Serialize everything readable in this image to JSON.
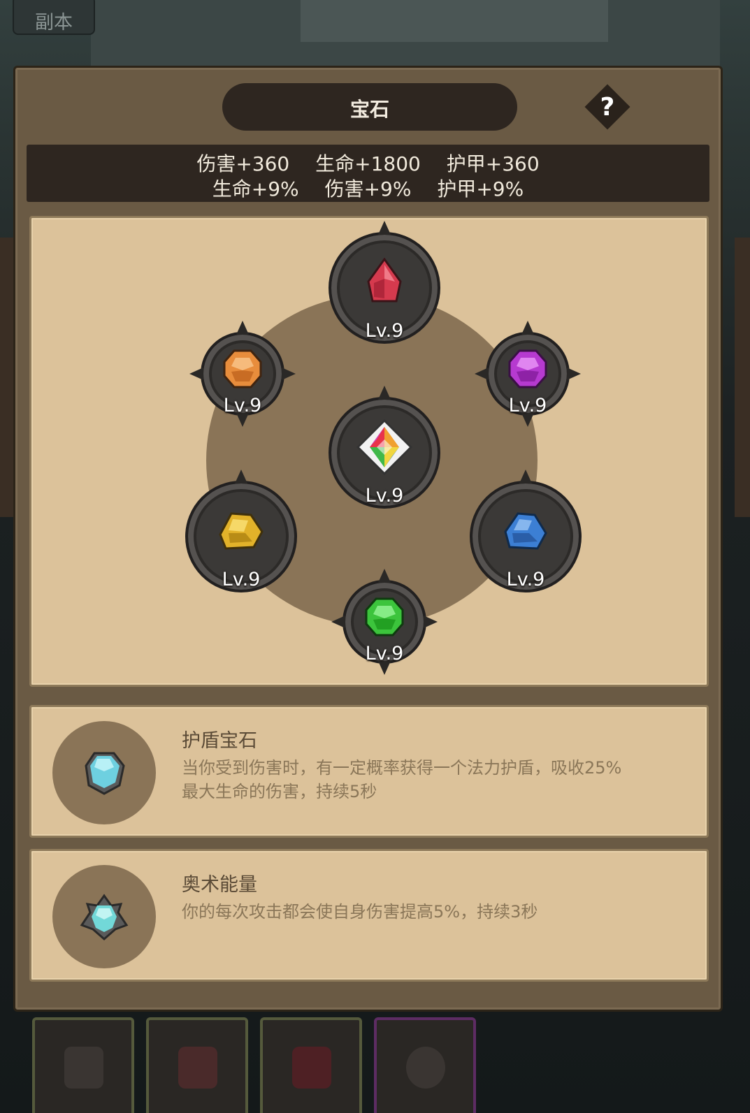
{
  "top_button": {
    "label": "副本"
  },
  "panel": {
    "title": "宝石",
    "help_label": "?"
  },
  "stats": {
    "line1": [
      "伤害+360",
      "生命+1800",
      "护甲+360"
    ],
    "line2": [
      "生命+9%",
      "伤害+9%",
      "护甲+9%"
    ]
  },
  "sockets": {
    "top": {
      "level": "Lv.9",
      "gem_color": "#d63a4e"
    },
    "upper_left": {
      "level": "Lv.9",
      "gem_color": "#e88d3c"
    },
    "upper_right": {
      "level": "Lv.9",
      "gem_color": "#b63ad0"
    },
    "center": {
      "level": "Lv.9",
      "gem_color": "rainbow"
    },
    "lower_left": {
      "level": "Lv.9",
      "gem_color": "#e2b22a"
    },
    "lower_right": {
      "level": "Lv.9",
      "gem_color": "#3c7fd4"
    },
    "bottom": {
      "level": "Lv.9",
      "gem_color": "#3cc43c"
    }
  },
  "skills": [
    {
      "name": "护盾宝石",
      "description": "当你受到伤害时，有一定概率获得一个法力护盾，吸收25%最大生命的伤害，持续5秒",
      "icon": "shield-gem-icon"
    },
    {
      "name": "奥术能量",
      "description": "你的每次攻击都会使自身伤害提高5%，持续3秒",
      "icon": "arcane-energy-icon"
    }
  ],
  "colors": {
    "panel_bg": "#6a5a44",
    "parchment": "#dcc29a",
    "dark_pill": "#2e2620"
  }
}
